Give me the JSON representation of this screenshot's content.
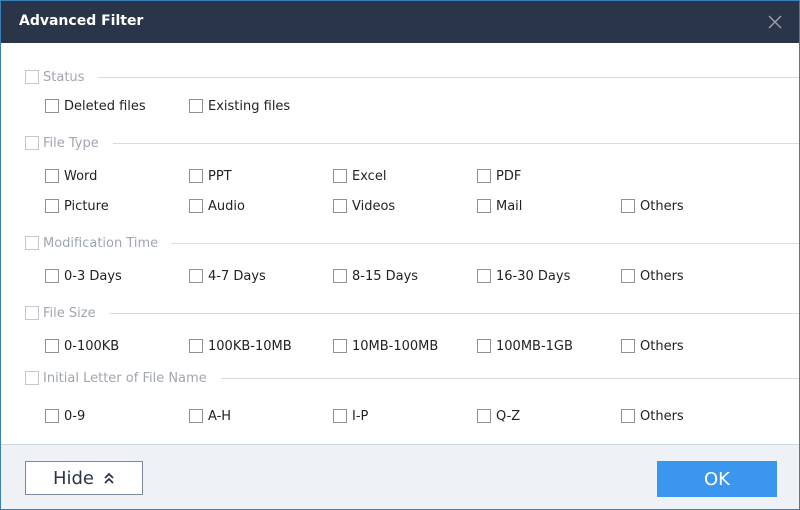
{
  "window": {
    "title": "Advanced Filter",
    "close_icon": "close-icon"
  },
  "sections": {
    "status": {
      "label": "Status",
      "checked": false,
      "options": [
        {
          "label": "Deleted files",
          "checked": false
        },
        {
          "label": "Existing files",
          "checked": false
        }
      ]
    },
    "file_type": {
      "label": "File Type",
      "checked": false,
      "options": [
        {
          "label": "Word",
          "checked": false
        },
        {
          "label": "PPT",
          "checked": false
        },
        {
          "label": "Excel",
          "checked": false
        },
        {
          "label": "PDF",
          "checked": false
        },
        {
          "label": "Picture",
          "checked": false
        },
        {
          "label": "Audio",
          "checked": false
        },
        {
          "label": "Videos",
          "checked": false
        },
        {
          "label": "Mail",
          "checked": false
        },
        {
          "label": "Others",
          "checked": false
        }
      ]
    },
    "modification_time": {
      "label": "Modification Time",
      "checked": false,
      "options": [
        {
          "label": "0-3 Days",
          "checked": false
        },
        {
          "label": "4-7 Days",
          "checked": false
        },
        {
          "label": "8-15 Days",
          "checked": false
        },
        {
          "label": "16-30 Days",
          "checked": false
        },
        {
          "label": "Others",
          "checked": false
        }
      ]
    },
    "file_size": {
      "label": "File Size",
      "checked": false,
      "options": [
        {
          "label": "0-100KB",
          "checked": false
        },
        {
          "label": "100KB-10MB",
          "checked": false
        },
        {
          "label": "10MB-100MB",
          "checked": false
        },
        {
          "label": "100MB-1GB",
          "checked": false
        },
        {
          "label": "Others",
          "checked": false
        }
      ]
    },
    "initial_letter": {
      "label": "Initial Letter of File Name",
      "checked": false,
      "options": [
        {
          "label": "0-9",
          "checked": false
        },
        {
          "label": "A-H",
          "checked": false
        },
        {
          "label": "I-P",
          "checked": false
        },
        {
          "label": "Q-Z",
          "checked": false
        },
        {
          "label": "Others",
          "checked": false
        }
      ]
    }
  },
  "footer": {
    "hide_label": "Hide",
    "hide_icon": "double-chevron-up-icon",
    "ok_label": "OK"
  },
  "colors": {
    "titlebar": "#2b354a",
    "accent": "#3a96ee",
    "border": "#3a7fb8"
  }
}
